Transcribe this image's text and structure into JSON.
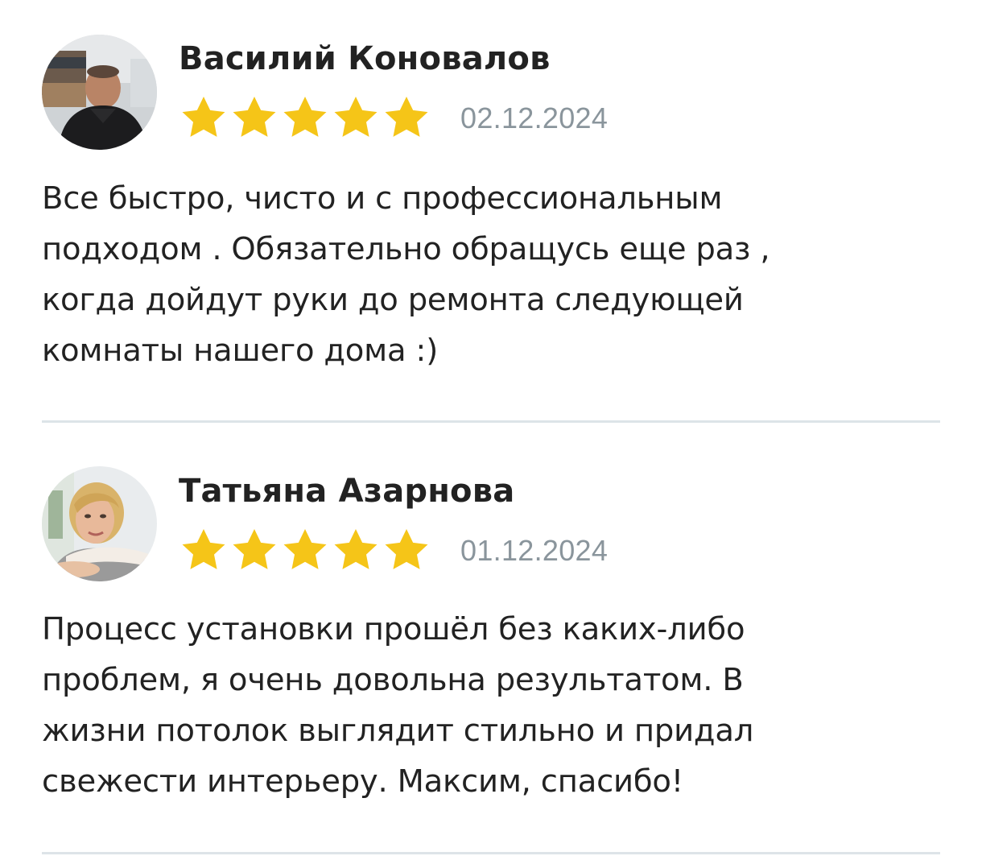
{
  "colors": {
    "star": "#f5c518",
    "date": "#8a959c",
    "text": "#222222",
    "divider": "#dde4e8"
  },
  "reviews": [
    {
      "author": "Василий Коновалов",
      "avatar_icon": "user-photo-man",
      "rating": 5,
      "rating_max": 5,
      "date": "02.12.2024",
      "text": "Все быстро, чисто и с профессиональным\nподходом . Обязательно обращусь еще раз ,\nкогда дойдут руки до ремонта следующей\nкомнаты нашего дома :)"
    },
    {
      "author": "Татьяна Азарнова",
      "avatar_icon": "user-photo-woman",
      "rating": 5,
      "rating_max": 5,
      "date": "01.12.2024",
      "text": "Процесс установки прошёл без каких-либо\nпроблем, я очень довольна результатом. В\nжизни потолок выглядит стильно и придал\nсвежести интерьеру. Максим, спасибо!"
    }
  ]
}
